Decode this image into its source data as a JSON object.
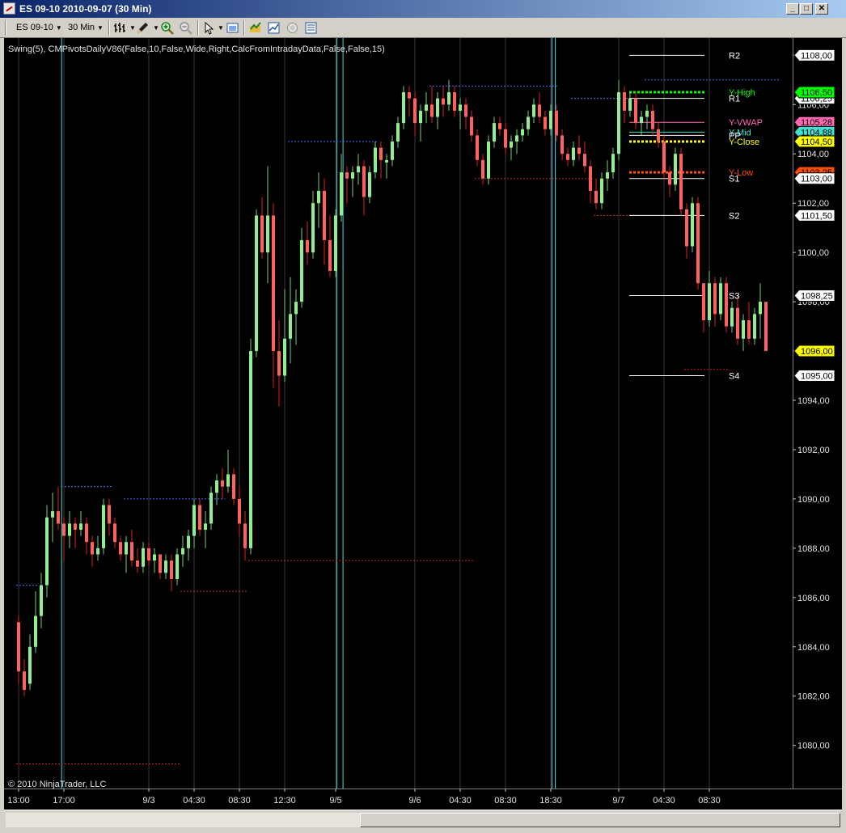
{
  "window": {
    "title": "ES 09-10  2010-09-07 (30 Min)",
    "btn_minimize": "_",
    "btn_maximize": "□",
    "btn_close": "✕"
  },
  "toolbar": {
    "instrument": "ES 09-10",
    "interval": "30 Min",
    "icons": [
      "bar-style-icon",
      "draw-pencil-icon",
      "zoom-in-icon",
      "zoom-out-icon",
      "pointer-icon",
      "chart-properties-icon",
      "strategies-icon",
      "indicators-icon",
      "data-box-icon",
      "chart-trader-icon"
    ]
  },
  "colors": {
    "background": "#000000",
    "up_bar": "#90ee90",
    "down_bar": "#ff6060",
    "up_wick": "#7ccd7c",
    "down_wick": "#e02020",
    "session_line": "#40e0e0",
    "grid": "#3a3a3a",
    "swing_high": "#4a6cff",
    "swing_low": "#d02020"
  },
  "chart_data": {
    "type": "candlestick",
    "indicator_label": "Swing(5),  CMPivotsDailyV86(False,10,False,Wide,Right,CalcFromIntradayData,False,False,15)",
    "copyright": "© 2010 NinjaTrader, LLC",
    "ylim": [
      1078.25,
      1108.7
    ],
    "y_ticks": [
      1080,
      1082,
      1084,
      1086,
      1088,
      1090,
      1092,
      1094,
      1096,
      1098,
      1100,
      1102,
      1104,
      1106,
      1108
    ],
    "y_tick_labels": [
      "1080,00",
      "1082,00",
      "1084,00",
      "1086,00",
      "1088,00",
      "1090,00",
      "1092,00",
      "1094,00",
      "1096,00",
      "1098,00",
      "1100,00",
      "1102,00",
      "1104,00",
      "1106,00",
      "1108,00"
    ],
    "x_labels": [
      {
        "label": "13:00",
        "bar": 0
      },
      {
        "label": "17:00",
        "bar": 8
      },
      {
        "label": "9/3",
        "bar": 23
      },
      {
        "label": "04:30",
        "bar": 31
      },
      {
        "label": "08:30",
        "bar": 39
      },
      {
        "label": "12:30",
        "bar": 47
      },
      {
        "label": "9/5",
        "bar": 56
      },
      {
        "label": "9/6",
        "bar": 70
      },
      {
        "label": "04:30",
        "bar": 78
      },
      {
        "label": "08:30",
        "bar": 86
      },
      {
        "label": "18:30",
        "bar": 94
      },
      {
        "label": "9/7",
        "bar": 106
      },
      {
        "label": "04:30",
        "bar": 114
      },
      {
        "label": "08:30",
        "bar": 122
      }
    ],
    "session_breaks": [
      7.6,
      56.2,
      57.3,
      94.2,
      94.8
    ],
    "bars": [
      [
        1085.0,
        1085.25,
        1082.5,
        1083.0
      ],
      [
        1083.0,
        1083.5,
        1082.0,
        1082.25
      ],
      [
        1082.5,
        1084.5,
        1082.25,
        1084.0
      ],
      [
        1084.0,
        1086.25,
        1083.75,
        1085.25
      ],
      [
        1085.25,
        1087.0,
        1084.75,
        1086.5
      ],
      [
        1086.5,
        1089.75,
        1086.0,
        1089.25
      ],
      [
        1089.25,
        1090.25,
        1088.25,
        1089.5
      ],
      [
        1089.5,
        1090.5,
        1088.75,
        1089.0
      ],
      [
        1089.0,
        1089.25,
        1087.5,
        1088.5
      ],
      [
        1088.5,
        1089.5,
        1088.0,
        1089.0
      ],
      [
        1089.0,
        1089.25,
        1088.0,
        1088.75
      ],
      [
        1088.75,
        1089.5,
        1088.5,
        1089.0
      ],
      [
        1089.0,
        1089.25,
        1087.75,
        1088.25
      ],
      [
        1088.25,
        1088.5,
        1087.25,
        1087.75
      ],
      [
        1087.75,
        1088.5,
        1087.5,
        1088.0
      ],
      [
        1088.0,
        1090.0,
        1087.75,
        1089.75
      ],
      [
        1089.75,
        1090.0,
        1088.5,
        1089.0
      ],
      [
        1089.0,
        1089.25,
        1088.0,
        1088.25
      ],
      [
        1088.25,
        1088.5,
        1087.5,
        1087.75
      ],
      [
        1087.75,
        1088.5,
        1087.0,
        1088.25
      ],
      [
        1088.25,
        1088.75,
        1087.25,
        1087.5
      ],
      [
        1087.5,
        1088.0,
        1087.0,
        1087.25
      ],
      [
        1087.25,
        1088.25,
        1087.0,
        1088.0
      ],
      [
        1088.0,
        1088.25,
        1087.25,
        1087.5
      ],
      [
        1087.5,
        1088.0,
        1087.0,
        1087.75
      ],
      [
        1087.75,
        1087.75,
        1086.75,
        1087.0
      ],
      [
        1087.0,
        1087.75,
        1086.75,
        1087.5
      ],
      [
        1087.5,
        1087.75,
        1086.25,
        1086.75
      ],
      [
        1086.75,
        1088.0,
        1086.5,
        1087.75
      ],
      [
        1087.75,
        1088.5,
        1087.25,
        1088.0
      ],
      [
        1088.0,
        1088.75,
        1087.5,
        1088.5
      ],
      [
        1088.5,
        1090.0,
        1088.0,
        1089.75
      ],
      [
        1089.75,
        1090.0,
        1088.5,
        1088.75
      ],
      [
        1088.75,
        1089.5,
        1088.0,
        1089.0
      ],
      [
        1089.0,
        1090.5,
        1088.75,
        1090.25
      ],
      [
        1090.25,
        1091.0,
        1089.75,
        1090.75
      ],
      [
        1090.75,
        1091.25,
        1090.0,
        1090.5
      ],
      [
        1090.5,
        1092.0,
        1090.25,
        1091.0
      ],
      [
        1091.0,
        1091.25,
        1089.75,
        1090.0
      ],
      [
        1090.0,
        1090.5,
        1088.5,
        1089.0
      ],
      [
        1089.0,
        1089.5,
        1087.5,
        1088.0
      ],
      [
        1088.0,
        1096.5,
        1087.75,
        1096.0
      ],
      [
        1096.0,
        1101.75,
        1095.75,
        1101.5
      ],
      [
        1101.5,
        1102.25,
        1099.75,
        1100.0
      ],
      [
        1100.0,
        1103.5,
        1098.75,
        1101.5
      ],
      [
        1101.5,
        1102.0,
        1094.5,
        1096.0
      ],
      [
        1096.0,
        1097.25,
        1093.75,
        1095.0
      ],
      [
        1095.0,
        1098.5,
        1094.75,
        1096.5
      ],
      [
        1096.5,
        1099.0,
        1095.5,
        1097.5
      ],
      [
        1097.5,
        1098.5,
        1096.25,
        1098.0
      ],
      [
        1098.0,
        1101.0,
        1097.75,
        1100.5
      ],
      [
        1100.5,
        1101.25,
        1099.5,
        1100.0
      ],
      [
        1100.0,
        1102.5,
        1099.75,
        1102.0
      ],
      [
        1102.0,
        1103.25,
        1101.0,
        1102.5
      ],
      [
        1102.5,
        1103.0,
        1099.5,
        1100.5
      ],
      [
        1100.5,
        1101.5,
        1099.0,
        1099.25
      ],
      [
        1099.25,
        1101.75,
        1099.0,
        1101.5
      ],
      [
        1101.5,
        1104.0,
        1101.25,
        1103.25
      ],
      [
        1103.25,
        1103.5,
        1102.0,
        1103.0
      ],
      [
        1103.0,
        1103.5,
        1102.25,
        1103.25
      ],
      [
        1103.25,
        1104.0,
        1102.75,
        1103.5
      ],
      [
        1103.5,
        1103.75,
        1101.5,
        1102.25
      ],
      [
        1102.25,
        1103.5,
        1102.0,
        1103.25
      ],
      [
        1103.25,
        1104.5,
        1103.0,
        1104.25
      ],
      [
        1104.25,
        1104.5,
        1103.0,
        1103.75
      ],
      [
        1103.75,
        1104.0,
        1103.0,
        1103.75
      ],
      [
        1103.75,
        1104.75,
        1103.5,
        1104.5
      ],
      [
        1104.5,
        1105.5,
        1104.25,
        1105.25
      ],
      [
        1105.25,
        1106.75,
        1105.0,
        1106.5
      ],
      [
        1106.5,
        1106.75,
        1105.5,
        1106.25
      ],
      [
        1106.25,
        1106.5,
        1104.75,
        1105.25
      ],
      [
        1105.25,
        1106.0,
        1104.5,
        1105.75
      ],
      [
        1105.75,
        1106.5,
        1105.25,
        1106.0
      ],
      [
        1106.0,
        1106.75,
        1105.25,
        1105.5
      ],
      [
        1105.5,
        1106.5,
        1105.0,
        1106.25
      ],
      [
        1106.25,
        1106.75,
        1105.5,
        1106.0
      ],
      [
        1106.0,
        1107.0,
        1105.75,
        1106.5
      ],
      [
        1106.5,
        1106.75,
        1105.5,
        1105.75
      ],
      [
        1105.75,
        1106.25,
        1105.0,
        1106.0
      ],
      [
        1106.0,
        1106.25,
        1105.0,
        1105.5
      ],
      [
        1105.5,
        1105.75,
        1104.5,
        1104.75
      ],
      [
        1104.75,
        1105.0,
        1103.5,
        1103.75
      ],
      [
        1103.75,
        1104.0,
        1102.75,
        1103.0
      ],
      [
        1103.0,
        1104.75,
        1102.75,
        1104.5
      ],
      [
        1104.5,
        1105.5,
        1104.25,
        1105.25
      ],
      [
        1105.25,
        1105.5,
        1104.75,
        1105.0
      ],
      [
        1105.0,
        1105.25,
        1104.0,
        1104.25
      ],
      [
        1104.25,
        1104.75,
        1103.75,
        1104.5
      ],
      [
        1104.5,
        1105.0,
        1104.0,
        1104.75
      ],
      [
        1104.75,
        1105.25,
        1104.5,
        1105.0
      ],
      [
        1105.0,
        1105.75,
        1104.75,
        1105.5
      ],
      [
        1105.5,
        1106.25,
        1105.25,
        1106.0
      ],
      [
        1106.0,
        1106.5,
        1105.25,
        1105.5
      ],
      [
        1105.5,
        1105.75,
        1104.75,
        1105.0
      ],
      [
        1105.0,
        1106.0,
        1104.75,
        1105.75
      ],
      [
        1105.75,
        1106.0,
        1104.5,
        1104.75
      ],
      [
        1104.75,
        1105.0,
        1103.75,
        1104.0
      ],
      [
        1104.0,
        1104.25,
        1103.5,
        1103.75
      ],
      [
        1103.75,
        1104.5,
        1103.5,
        1104.25
      ],
      [
        1104.25,
        1104.75,
        1103.75,
        1104.0
      ],
      [
        1104.0,
        1104.5,
        1103.25,
        1103.5
      ],
      [
        1103.5,
        1103.75,
        1102.0,
        1102.5
      ],
      [
        1102.5,
        1103.0,
        1101.75,
        1102.0
      ],
      [
        1102.0,
        1103.25,
        1101.75,
        1103.0
      ],
      [
        1103.0,
        1103.75,
        1102.5,
        1103.25
      ],
      [
        1103.25,
        1104.25,
        1103.0,
        1104.0
      ],
      [
        1104.0,
        1107.0,
        1103.75,
        1106.5
      ],
      [
        1106.5,
        1106.75,
        1105.25,
        1105.75
      ],
      [
        1105.75,
        1106.5,
        1105.5,
        1106.25
      ],
      [
        1106.25,
        1106.5,
        1105.0,
        1105.25
      ],
      [
        1105.25,
        1105.75,
        1104.75,
        1105.5
      ],
      [
        1105.5,
        1106.0,
        1105.0,
        1105.75
      ],
      [
        1105.75,
        1106.0,
        1104.75,
        1105.0
      ],
      [
        1105.0,
        1105.25,
        1104.25,
        1104.5
      ],
      [
        1104.5,
        1104.75,
        1103.0,
        1103.25
      ],
      [
        1103.25,
        1103.5,
        1102.25,
        1102.75
      ],
      [
        1102.75,
        1104.25,
        1102.5,
        1104.0
      ],
      [
        1104.0,
        1104.25,
        1101.5,
        1101.75
      ],
      [
        1101.75,
        1102.0,
        1099.75,
        1100.25
      ],
      [
        1100.25,
        1102.25,
        1100.0,
        1102.0
      ],
      [
        1102.0,
        1102.25,
        1098.5,
        1098.75
      ],
      [
        1098.75,
        1098.75,
        1096.75,
        1097.25
      ],
      [
        1097.25,
        1099.25,
        1097.0,
        1098.75
      ],
      [
        1098.75,
        1099.0,
        1097.0,
        1097.5
      ],
      [
        1097.5,
        1099.0,
        1097.25,
        1098.75
      ],
      [
        1098.75,
        1099.0,
        1096.75,
        1097.0
      ],
      [
        1097.0,
        1098.0,
        1096.75,
        1097.75
      ],
      [
        1097.75,
        1098.25,
        1096.25,
        1096.5
      ],
      [
        1096.5,
        1097.5,
        1096.0,
        1097.25
      ],
      [
        1097.25,
        1098.0,
        1096.25,
        1096.5
      ],
      [
        1096.5,
        1097.75,
        1096.25,
        1097.5
      ],
      [
        1097.5,
        1098.75,
        1096.5,
        1098.0
      ],
      [
        1098.0,
        1098.0,
        1096.0,
        1096.0
      ]
    ],
    "swing_highs": [
      {
        "from": 0,
        "to": 3,
        "price": 1086.5
      },
      {
        "from": 8,
        "to": 16,
        "price": 1090.5
      },
      {
        "from": 19,
        "to": 36,
        "price": 1090.0
      },
      {
        "from": 48,
        "to": 63,
        "price": 1104.5
      },
      {
        "from": 73,
        "to": 95,
        "price": 1106.75
      },
      {
        "from": 98,
        "to": 109,
        "price": 1106.25
      },
      {
        "from": 111,
        "to": 134,
        "price": 1107.0
      }
    ],
    "swing_lows": [
      {
        "from": 0,
        "to": 28,
        "price": 1079.25
      },
      {
        "from": 29,
        "to": 40,
        "price": 1086.25
      },
      {
        "from": 41,
        "to": 80,
        "price": 1087.5
      },
      {
        "from": 81,
        "to": 101,
        "price": 1103.0
      },
      {
        "from": 102,
        "to": 114,
        "price": 1101.5
      },
      {
        "from": 118,
        "to": 125,
        "price": 1095.25
      }
    ],
    "pivots": [
      {
        "name": "R2",
        "price": 1108.0,
        "style": "solid",
        "color": "#ffffff",
        "label_color": "#ffffff",
        "tag": "1108,00"
      },
      {
        "name": "R1",
        "price": 1106.25,
        "style": "solid",
        "color": "#ffffff",
        "label_color": "#ffffff",
        "tag": "1106,25"
      },
      {
        "name": "Y-High",
        "price": 1106.5,
        "style": "dotted",
        "color": "#00ff00",
        "label_color": "#00ff00",
        "tag": "1106,50",
        "tag_bg": "#00ff00"
      },
      {
        "name": "Y-VWAP",
        "price": 1105.28,
        "style": "solid",
        "color": "#ff69b4",
        "label_color": "#ff69b4",
        "tag": "1105,28",
        "tag_bg": "#ff69b4"
      },
      {
        "name": "Y-Mid",
        "price": 1104.88,
        "style": "solid",
        "color": "#40e0d0",
        "label_color": "#40e0d0",
        "tag": "1104,88",
        "tag_bg": "#40e0d0"
      },
      {
        "name": "PP",
        "price": 1104.75,
        "style": "solid",
        "color": "#ffffff",
        "label_color": "#ffffff",
        "tag": ""
      },
      {
        "name": "Y-Close",
        "price": 1104.5,
        "style": "dotted",
        "color": "#ffff00",
        "label_color": "#ffff00",
        "tag": "1104,50",
        "tag_bg": "#ffff00"
      },
      {
        "name": "Y-Low",
        "price": 1103.25,
        "style": "dotted",
        "color": "#ff5000",
        "label_color": "#ff5000",
        "tag": "1103,25",
        "tag_bg": "#ff5000"
      },
      {
        "name": "S1",
        "price": 1103.0,
        "style": "solid",
        "color": "#ffffff",
        "label_color": "#ffffff",
        "tag": "1103,00"
      },
      {
        "name": "S2",
        "price": 1101.5,
        "style": "solid",
        "color": "#ffffff",
        "label_color": "#ffffff",
        "tag": "1101,50"
      },
      {
        "name": "S3",
        "price": 1098.25,
        "style": "solid",
        "color": "#ffffff",
        "label_color": "#ffffff",
        "tag": "1098,25"
      },
      {
        "name": "S4",
        "price": 1095.0,
        "style": "solid",
        "color": "#ffffff",
        "label_color": "#ffffff",
        "tag": "1095,00"
      }
    ],
    "last_price": {
      "value": 1096.0,
      "tag": "1096,00",
      "tag_bg": "#ffff00"
    }
  }
}
